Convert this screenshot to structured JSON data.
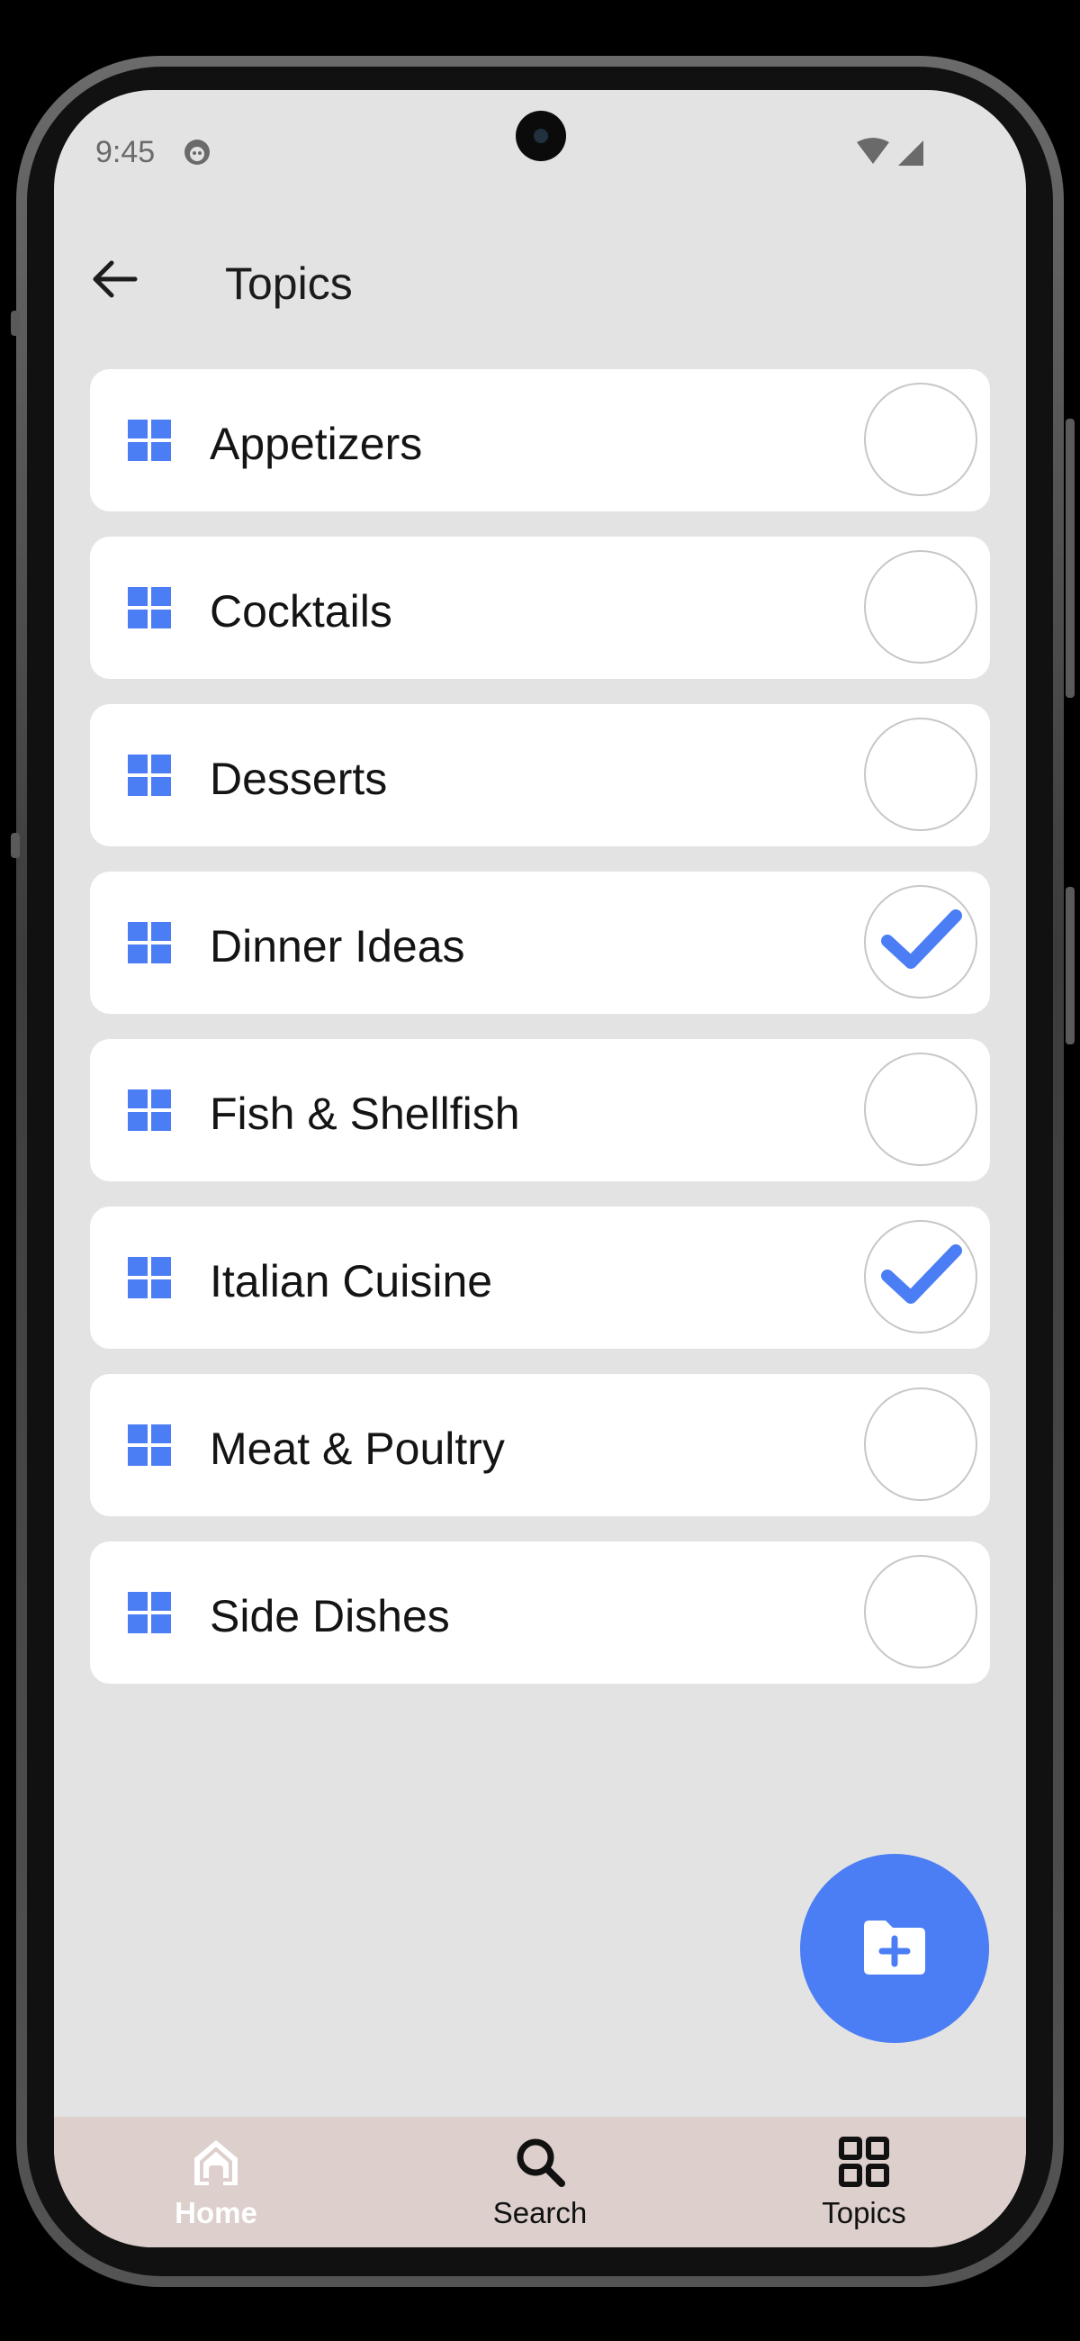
{
  "status_bar": {
    "time": "9:45"
  },
  "header": {
    "title": "Topics"
  },
  "topics": [
    {
      "label": "Appetizers",
      "selected": false
    },
    {
      "label": "Cocktails",
      "selected": false
    },
    {
      "label": "Desserts",
      "selected": false
    },
    {
      "label": "Dinner Ideas",
      "selected": true
    },
    {
      "label": "Fish & Shellfish",
      "selected": false
    },
    {
      "label": "Italian Cuisine",
      "selected": true
    },
    {
      "label": "Meat & Poultry",
      "selected": false
    },
    {
      "label": "Side Dishes",
      "selected": false
    }
  ],
  "bottom_nav": {
    "home_label": "Home",
    "search_label": "Search",
    "topics_label": "Topics"
  },
  "colors": {
    "accent": "#4b7df4",
    "nav_background": "#dccfcc",
    "screen_background": "#e3e3e3"
  },
  "icons": {
    "back": "arrow-left-icon",
    "topic": "grid-icon",
    "check": "check-icon",
    "fab": "folder-plus-icon",
    "home": "home-icon",
    "search": "search-icon",
    "topics": "grid-outline-icon"
  }
}
